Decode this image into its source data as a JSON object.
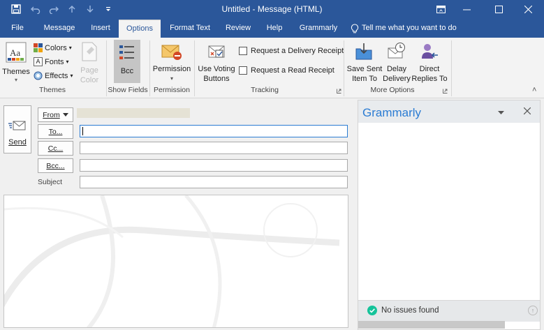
{
  "window": {
    "title": "Untitled - Message (HTML)"
  },
  "tabs": [
    "File",
    "Message",
    "Insert",
    "Options",
    "Format Text",
    "Review",
    "Help",
    "Grammarly"
  ],
  "tell_me": "Tell me what you want to do",
  "ribbon": {
    "themes": {
      "themes_label": "Themes",
      "colors_label": "Colors",
      "fonts_label": "Fonts",
      "effects_label": "Effects",
      "page_color_label": "Page Color",
      "group": "Themes"
    },
    "show_fields": {
      "bcc_label": "Bcc",
      "group": "Show Fields"
    },
    "permission": {
      "label": "Permission",
      "group": "Permission"
    },
    "tracking": {
      "voting_label": "Use Voting Buttons",
      "delivery_receipt": "Request a Delivery Receipt",
      "read_receipt": "Request a Read Receipt",
      "group": "Tracking"
    },
    "more_options": {
      "save_sent_label": "Save Sent Item To",
      "delay_label": "Delay Delivery",
      "direct_label": "Direct Replies To",
      "group": "More Options"
    }
  },
  "compose": {
    "send_label": "Send",
    "from_label": "From",
    "to_label": "To...",
    "cc_label": "Cc...",
    "bcc_label": "Bcc...",
    "subject_label": "Subject"
  },
  "grammarly": {
    "title": "Grammarly",
    "status": "No issues found"
  },
  "colors": {
    "accent": "#2b579a",
    "grammarly_green": "#15c39a"
  }
}
